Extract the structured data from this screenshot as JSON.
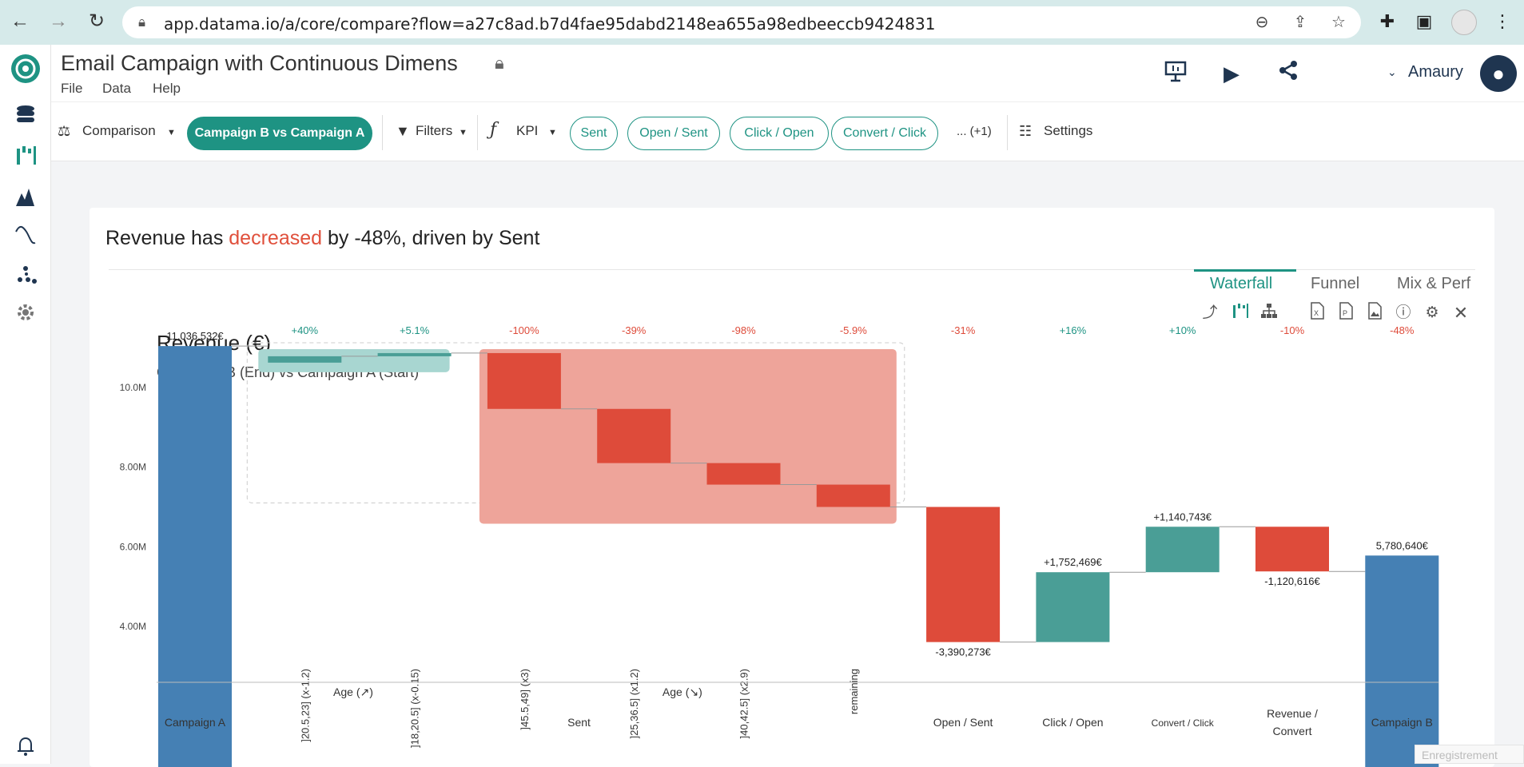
{
  "browser": {
    "url": "app.datama.io/a/core/compare?flow=a27c8ad.b7d4fae95dabd2148ea655a98edbeeccb9424831"
  },
  "header": {
    "title": "Email Campaign with Continuous Dimens",
    "menu": [
      "File",
      "Data",
      "Help"
    ],
    "user": "Amaury"
  },
  "toolbar": {
    "comparison_label": "Comparison",
    "comparison_value": "Campaign B vs Campaign A",
    "filters_label": "Filters",
    "kpi_label": "KPI",
    "kpis": [
      "Sent",
      "Open / Sent",
      "Click / Open",
      "Convert / Click"
    ],
    "more_label": "... (+1)",
    "settings_label": "Settings"
  },
  "card": {
    "headline_prefix": "Revenue has ",
    "headline_keyword": "decreased",
    "headline_suffix": " by -48%, driven by Sent",
    "tabs": [
      "Waterfall",
      "Funnel",
      "Mix & Perf"
    ],
    "active_tab": "Waterfall"
  },
  "chart_data": {
    "type": "waterfall",
    "title": "Revenue (€)",
    "subtitle": "Campaign B (End) vs Campaign A (Start)",
    "unit": "€",
    "yticks": [
      "4.00M",
      "6.00M",
      "8.00M",
      "10.0M"
    ],
    "y_tick_values": [
      4000000,
      6000000,
      8000000,
      10000000
    ],
    "ylim": [
      2600000,
      11500000
    ],
    "colors": {
      "total": "#4580b4",
      "up": "#4a9e96",
      "down": "#de4b3a",
      "up_area": "#a8d6d1",
      "down_area": "#eea49a"
    },
    "columns": [
      {
        "label": "Campaign A",
        "pct": "",
        "type": "total",
        "start": 0,
        "end": 11036532,
        "value_label": "11,036,532€"
      },
      {
        "label": "]20.5,23] (x-1.2)",
        "pct": "+40%",
        "type": "up",
        "start": 10620000,
        "end": 10780000
      },
      {
        "label": "]18,20.5] (x-0.15)",
        "pct": "+5.1%",
        "type": "up",
        "start": 10780000,
        "end": 10860000
      },
      {
        "label": "]45.5,49] (x3)",
        "pct": "-100%",
        "type": "down",
        "start": 10860000,
        "end": 9460000
      },
      {
        "label": "]25,36.5] (x1.2)",
        "pct": "-39%",
        "type": "down",
        "start": 9460000,
        "end": 8100000
      },
      {
        "label": "]40,42.5] (x2.9)",
        "pct": "-98%",
        "type": "down",
        "start": 8100000,
        "end": 7560000
      },
      {
        "label": "remaining",
        "pct": "-5.9%",
        "type": "down",
        "start": 7560000,
        "end": 7000000
      },
      {
        "label": "Open / Sent",
        "pct": "-31%",
        "type": "down",
        "start": 7000000,
        "end": 3609727,
        "value_label": "-3,390,273€"
      },
      {
        "label": "Click / Open",
        "pct": "+16%",
        "type": "up",
        "start": 3609727,
        "end": 5362196,
        "value_label": "+1,752,469€"
      },
      {
        "label": "Convert / Click",
        "pct": "+10%",
        "type": "up",
        "start": 5362196,
        "end": 6502939,
        "value_label": "+1,140,743€"
      },
      {
        "label": "Revenue / Convert",
        "pct": "-10%",
        "type": "down",
        "start": 6502939,
        "end": 5382323,
        "value_label": "-1,120,616€"
      },
      {
        "label": "Campaign B",
        "pct": "-48%",
        "type": "total",
        "start": 0,
        "end": 5780640,
        "value_label": "5,780,640€"
      }
    ],
    "groups": [
      {
        "label": "Age (↗)",
        "type": "up"
      },
      {
        "label": "Age (↘)",
        "type": "down"
      }
    ],
    "group_label": "Sent",
    "bottom_labels": [
      "Campaign A",
      "Sent",
      "Open / Sent",
      "Click / Open",
      "Convert / Click",
      "Revenue / Convert",
      "Campaign B"
    ]
  },
  "footer": {
    "record_label": "Enregistrement"
  }
}
